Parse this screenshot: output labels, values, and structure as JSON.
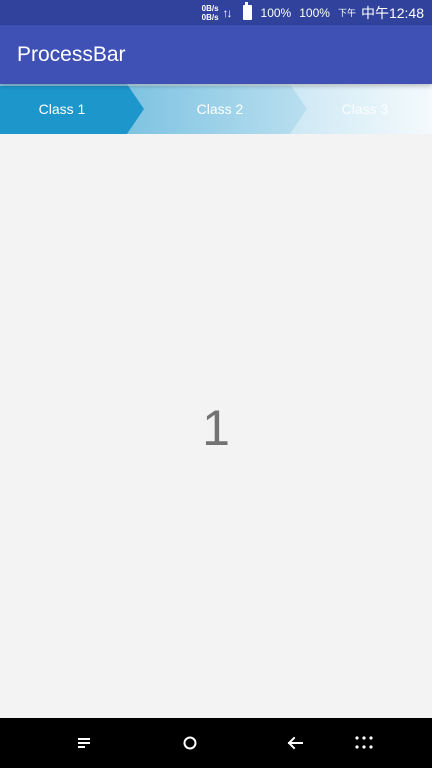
{
  "status_bar": {
    "net_speed_up": "0B/s",
    "net_speed_down": "0B/s",
    "data_icon": "data-transfer-icon",
    "battery_icon": "battery-icon",
    "battery_percent": "100%",
    "battery_percent_2": "100%",
    "ampm": "下午",
    "clock": "中午12:48"
  },
  "app_bar": {
    "title": "ProcessBar"
  },
  "process_bar": {
    "steps": [
      {
        "label": "Class 1"
      },
      {
        "label": "Class 2"
      },
      {
        "label": "Class 3"
      }
    ],
    "active_color": "#1d96cc"
  },
  "content": {
    "number": "1"
  },
  "nav_bar": {
    "icons": [
      "menu-icon",
      "home-icon",
      "back-icon",
      "apps-grid-icon"
    ]
  },
  "colors": {
    "status_bar": "#30429c",
    "app_bar": "#3f51b5",
    "background": "#f3f3f3"
  }
}
